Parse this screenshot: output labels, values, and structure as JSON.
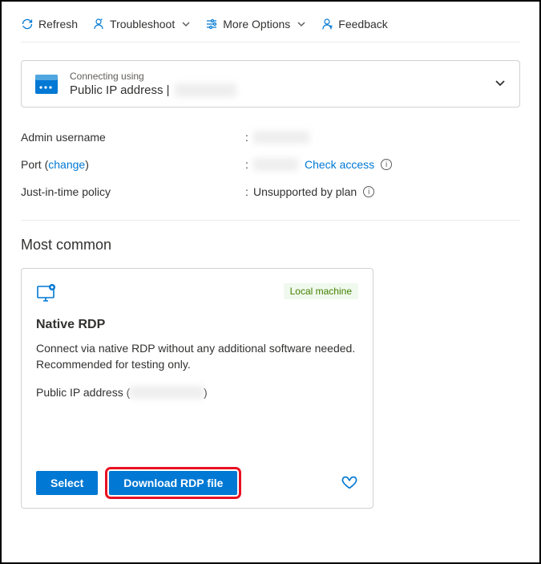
{
  "toolbar": {
    "refresh": "Refresh",
    "troubleshoot": "Troubleshoot",
    "more_options": "More Options",
    "feedback": "Feedback"
  },
  "connection": {
    "label": "Connecting using",
    "value": "Public IP address |",
    "masked": "xxx.xxx"
  },
  "details": {
    "admin_label": "Admin username",
    "admin_value": "xxxxxx",
    "port_label": "Port",
    "port_change": "change",
    "port_value": "xxxx",
    "port_check": "Check access",
    "jit_label": "Just-in-time policy",
    "jit_value": "Unsupported by plan"
  },
  "section_title": "Most common",
  "rdp": {
    "badge": "Local machine",
    "title": "Native RDP",
    "desc": "Connect via native RDP without any additional software needed. Recommended for testing only.",
    "ip_label": "Public IP address (",
    "ip_masked": "xxx.xxx.xx",
    "ip_close": ")",
    "select": "Select",
    "download": "Download RDP file"
  }
}
